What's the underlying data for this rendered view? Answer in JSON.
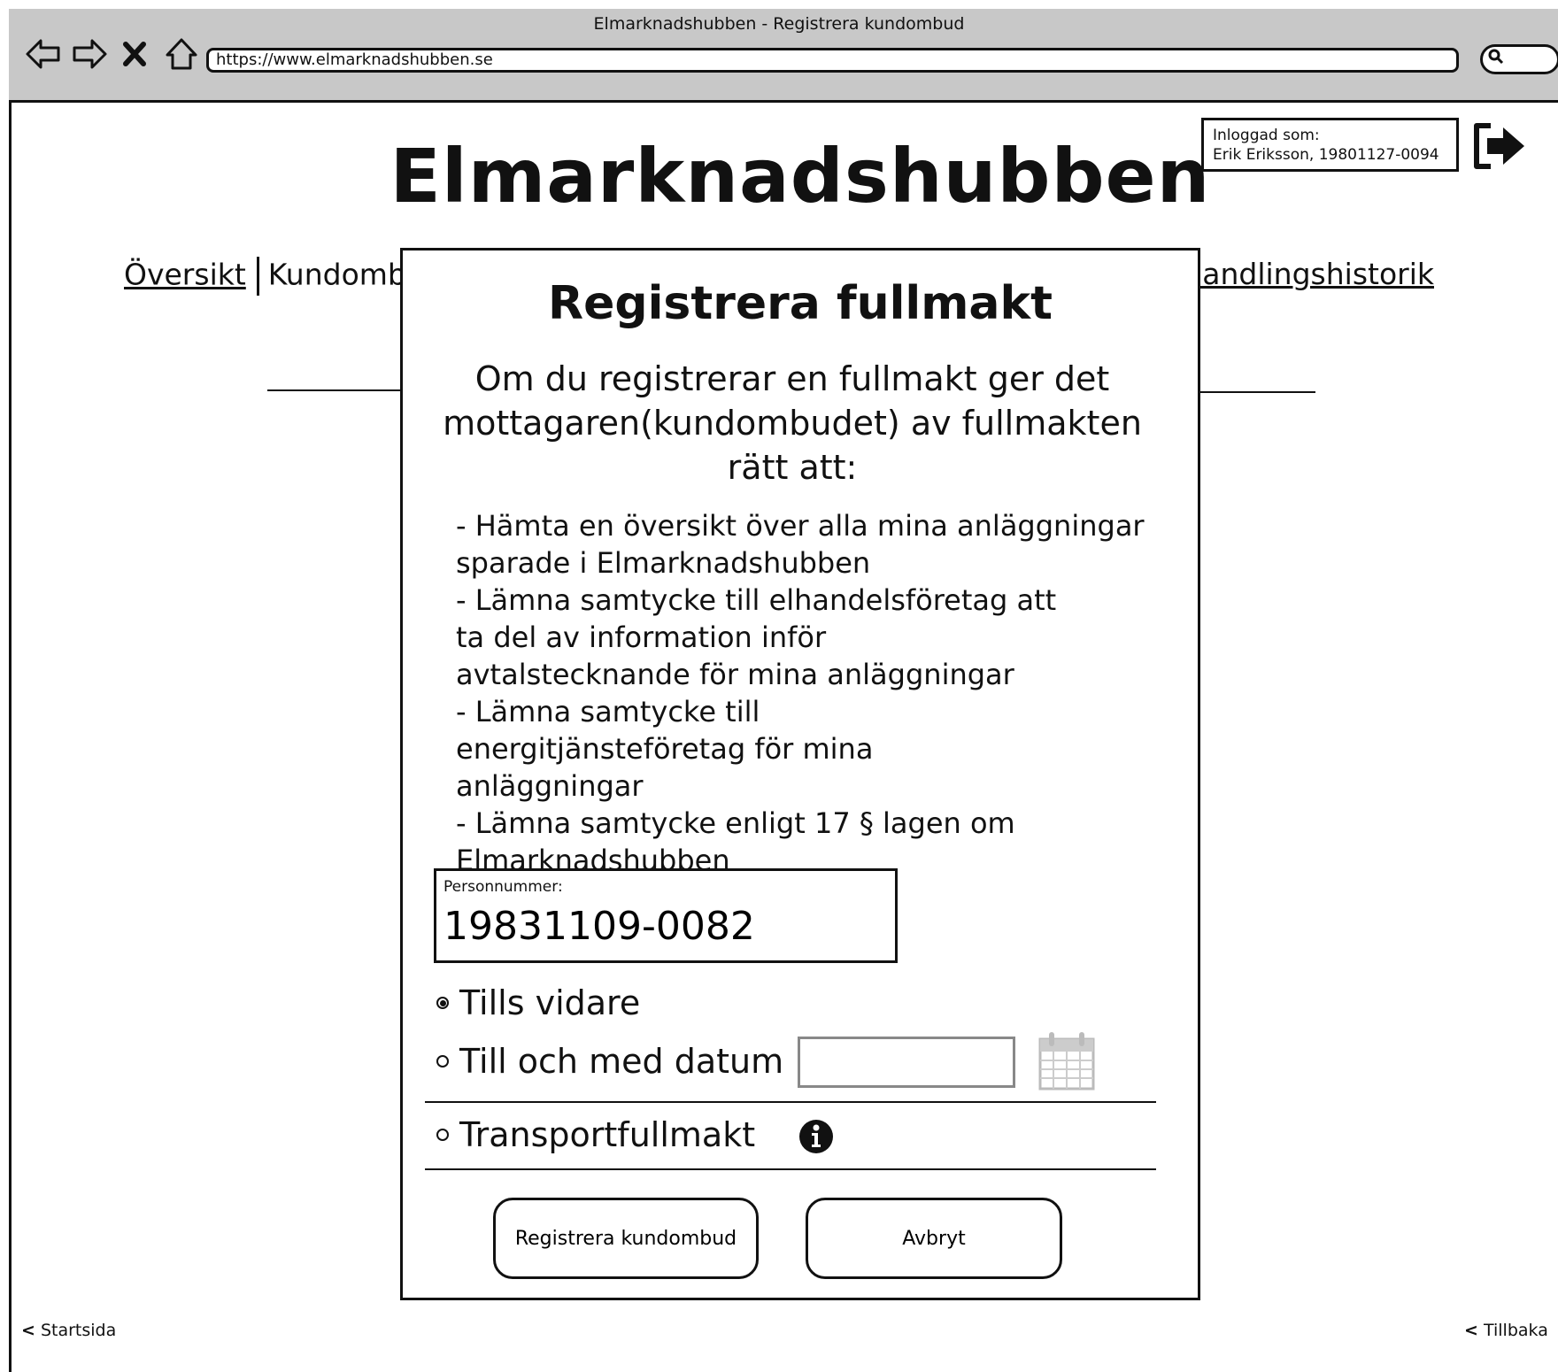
{
  "window": {
    "title": "Elmarknadshubben - Registrera kundombud",
    "url": "https://www.elmarknadshubben.se"
  },
  "header": {
    "site_title": "Elmarknadshubben",
    "login_label": "Inloggad som:",
    "login_user": "Erik Eriksson, 19801127-0094"
  },
  "nav": {
    "item_overview": "Översikt",
    "item_agents_partial": "Kundomb",
    "item_history_partial": "handlingshistorik"
  },
  "modal": {
    "title": "Registrera fullmakt",
    "intro": "Om du registrerar en fullmakt ger det mottagaren(kundombudet) av fullmakten rätt att:",
    "items": [
      "- Hämta en översikt över alla mina anläggningar sparade i Elmarknadshubben",
      "- Lämna samtycke till elhandelsföretag att ta del av information inför avtalstecknande för mina anläggningar",
      "- Lämna samtycke till energitjänsteföretag för mina anläggningar",
      "- Lämna samtycke enligt 17 § lagen om Elmarknadshubben"
    ],
    "personnummer_label": "Personnummer:",
    "personnummer_value": "19831109-0082",
    "option_until_further": "Tills vidare",
    "option_until_date": "Till och med datum",
    "option_transport": "Transportfullmakt",
    "button_register": "Registrera kundombud",
    "button_cancel": "Avbryt"
  },
  "footer": {
    "left_link": "Startsida",
    "right_link": "Tillbaka"
  }
}
